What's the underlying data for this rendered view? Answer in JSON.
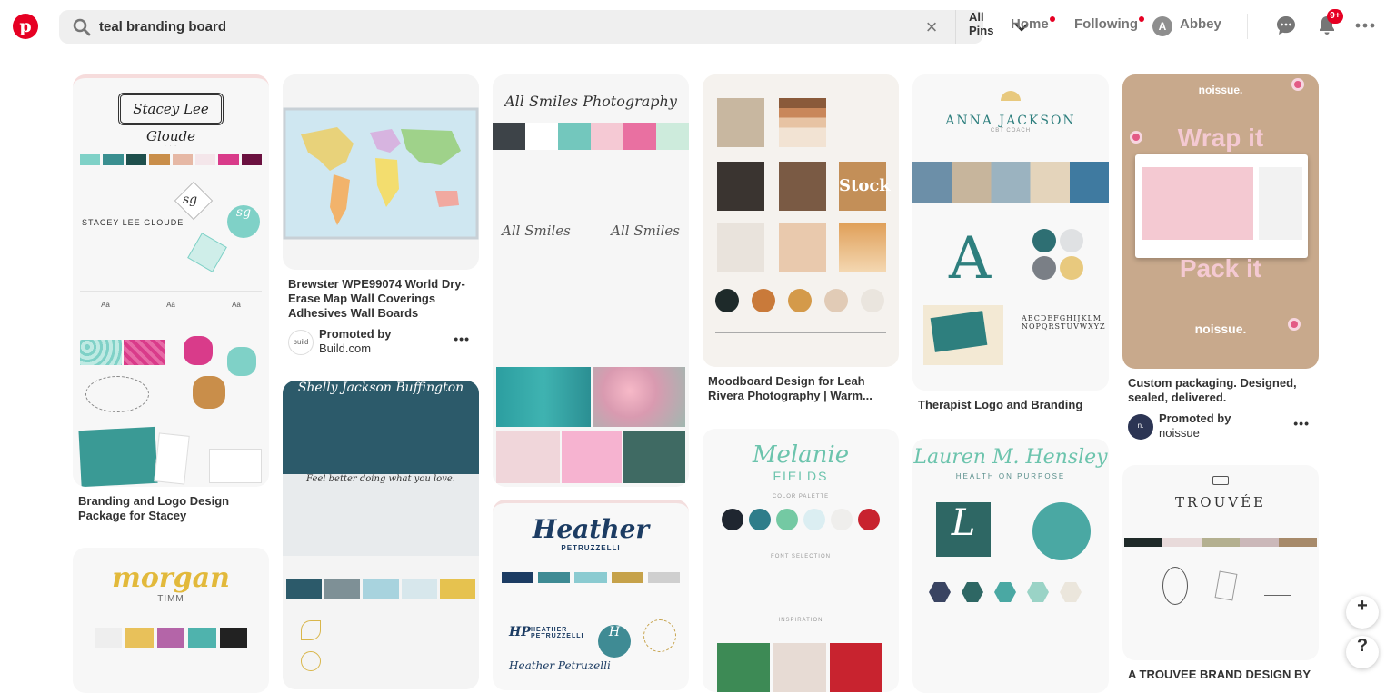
{
  "header": {
    "logo": "p",
    "search": {
      "value": "teal branding board",
      "clear": "×",
      "scope": "All Pins"
    },
    "nav": {
      "home": "Home",
      "following": "Following",
      "user_initial": "A",
      "user_name": "Abbey"
    },
    "notification_badge": "9+"
  },
  "pins": [
    {
      "caption": "Branding and Logo Design Package for Stacey",
      "art": {
        "brand": "Stacey Lee Gloude",
        "name": "STACEY LEE GLOUDE",
        "monogram": "sg"
      }
    },
    {
      "caption": "Brewster WPE99074 World Dry-Erase Map Wall Coverings Adhesives Wall Boards",
      "promoted_by": "Promoted by",
      "advertiser": "Build.com",
      "advertiser_logo": "build"
    },
    {
      "art": {
        "brand": "Shelly Jackson Buffington",
        "tagline": "Feel better doing what you love."
      }
    },
    {
      "art": {
        "brand": "All Smiles Photography",
        "mark": "All Smiles"
      }
    },
    {
      "art": {
        "brand": "Heather",
        "surname": "PETRUZZELLI",
        "monogram": "HP",
        "name": "HEATHER PETRUZZELLI",
        "script": "Heather Petruzelli"
      }
    },
    {
      "caption": "Moodboard Design for Leah Rivera Photography | Warm...",
      "art": {
        "overlay": "Stock"
      }
    },
    {
      "art": {
        "brand": "Melanie",
        "surname": "FIELDS",
        "palette_label": "COLOR PALETTE",
        "font_label": "FONT SELECTION",
        "inspo_label": "INSPIRATION"
      }
    },
    {
      "caption": "Therapist Logo and Branding",
      "art": {
        "brand": "ANNA JACKSON",
        "role": "CBT COACH",
        "letter": "A",
        "type": "ABCDEFGHIJKLM NOPQRSTUVWXYZ"
      }
    },
    {
      "art": {
        "brand": "Lauren M. Hensley",
        "tagline": "HEALTH ON PURPOSE",
        "letter": "L"
      }
    },
    {
      "caption": "Custom packaging. Designed, sealed, delivered.",
      "promoted_by": "Promoted by",
      "advertiser": "noissue",
      "art": {
        "brand": "noissue.",
        "line1": "Wrap it",
        "line2": "Pack it"
      }
    },
    {
      "caption": "A TROUVEE BRAND DESIGN BY",
      "art": {
        "brand": "TROUVÉE"
      }
    },
    {
      "art": {
        "brand": "morgan",
        "surname": "TIMM"
      }
    }
  ],
  "fab": {
    "add": "+",
    "help": "?"
  },
  "colors": {
    "brand_red": "#e60023",
    "teal": "#2f7b7a",
    "mint": "#7fc7bd"
  }
}
